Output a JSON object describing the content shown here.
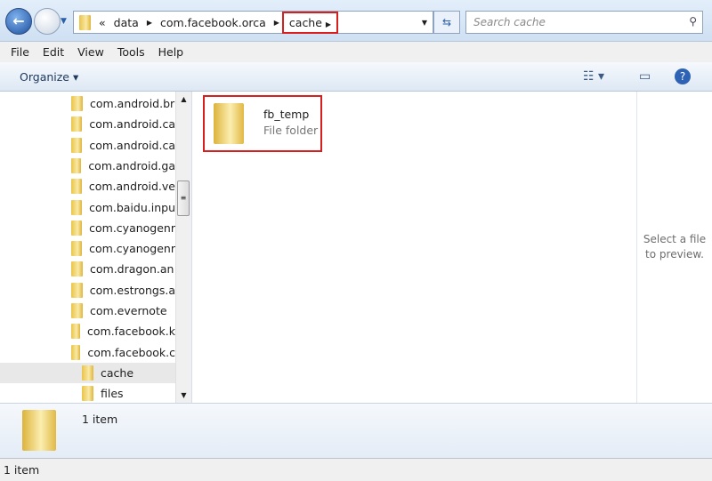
{
  "address": {
    "overflow": "«",
    "crumbs": [
      "data",
      "com.facebook.orca",
      "cache"
    ],
    "highlight_color": "#d62020"
  },
  "search": {
    "placeholder": "Search cache"
  },
  "menu": [
    "File",
    "Edit",
    "View",
    "Tools",
    "Help"
  ],
  "toolbar": {
    "organize": "Organize ▾"
  },
  "nav": {
    "items": [
      "com.android.br",
      "com.android.ca",
      "com.android.ca",
      "com.android.ga",
      "com.android.ve",
      "com.baidu.inpu",
      "com.cyanogenr",
      "com.cyanogenr",
      "com.dragon.an",
      "com.estrongs.a",
      "com.evernote",
      "com.facebook.k",
      "com.facebook.c"
    ],
    "children": [
      "cache",
      "files"
    ],
    "selected": "cache"
  },
  "content": {
    "item": {
      "name": "fb_temp",
      "type": "File folder"
    }
  },
  "preview": {
    "text": "Select a file to preview."
  },
  "details": {
    "count": "1 item"
  },
  "status": {
    "text": "1 item"
  }
}
